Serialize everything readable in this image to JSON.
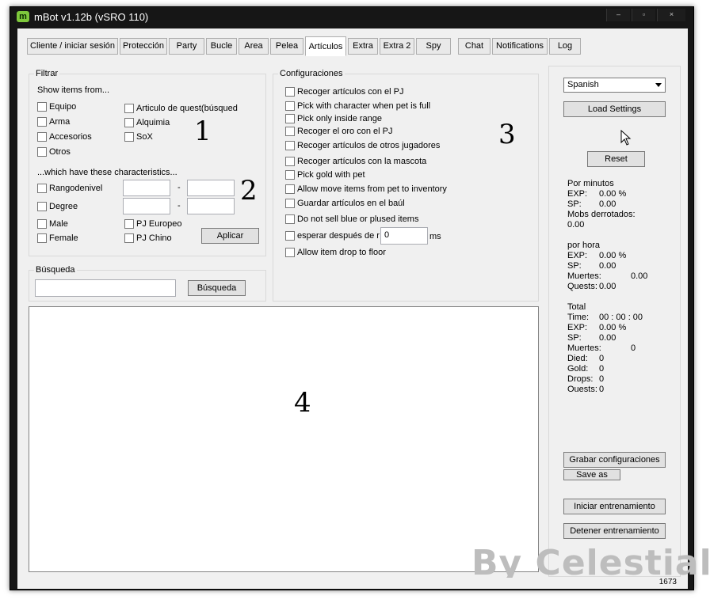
{
  "window": {
    "title": "mBot v1.12b (vSRO 110)",
    "logo_letter": "m",
    "min": "–",
    "max": "▫",
    "close": "×"
  },
  "tabs": [
    "Cliente / iniciar sesión",
    "Protección",
    "Party",
    "Bucle",
    "Area",
    "Pelea",
    "Artículos",
    "Extra",
    "Extra 2",
    "Spy",
    "Chat",
    "Notifications",
    "Log"
  ],
  "active_tab": "Artículos",
  "filtrar": {
    "legend": "Filtrar",
    "show_items_from": "Show items from...",
    "left_items": [
      "Equipo",
      "Arma",
      "Accesorios",
      "Otros"
    ],
    "right_items": [
      "Articulo de quest(búsqued",
      "Alquimia",
      "SoX"
    ],
    "characteristics_label": "...which have these characteristics...",
    "range_items": [
      "Rangodenivel",
      "Degree"
    ],
    "dash": "-",
    "gender_items": [
      "Male",
      "Female"
    ],
    "race_items": [
      "PJ Europeo",
      "PJ Chino"
    ],
    "apply_button": "Aplicar"
  },
  "busqueda": {
    "legend": "Búsqueda",
    "input_value": "",
    "search_button": "Búsqueda"
  },
  "configuraciones": {
    "legend": "Configuraciones",
    "items": [
      "Recoger artículos con el PJ",
      "Pick with character when pet is full",
      "Pick only inside range",
      "Recoger el oro con el PJ",
      "Recoger artículos de otros jugadores",
      "Recoger artículos con la mascota",
      "Pick gold with pet",
      "Allow move items from pet to inventory",
      "Guardar artículos en el baúl",
      "Do not sell blue or plused items",
      "esperar después de r",
      "Allow item drop to floor"
    ],
    "wait_value": "0",
    "wait_unit": "ms"
  },
  "annotations": [
    "1",
    "2",
    "3",
    "4"
  ],
  "right_panel": {
    "language": "Spanish",
    "load_settings": "Load Settings",
    "reset": "Reset",
    "por_minutos": {
      "header": "Por minutos",
      "exp_label": "EXP:",
      "exp_value": "0.00 %",
      "sp_label": "SP:",
      "sp_value": "0.00",
      "mobs_label": "Mobs derrotados:",
      "mobs_value": "0.00"
    },
    "por_hora": {
      "header": "por hora",
      "exp_label": "EXP:",
      "exp_value": "0.00 %",
      "sp_label": "SP:",
      "sp_value": "0.00",
      "muertes_label": "Muertes:",
      "muertes_value": "0.00",
      "quests_label": "Quests:",
      "quests_value": "0.00"
    },
    "total": {
      "header": "Total",
      "time_label": "Time:",
      "time_value": "00 : 00 : 00",
      "exp_label": "EXP:",
      "exp_value": "0.00 %",
      "sp_label": "SP:",
      "sp_value": "0.00",
      "muertes_label": "Muertes:",
      "muertes_value": "0",
      "died_label": "Died:",
      "died_value": "0",
      "gold_label": "Gold:",
      "gold_value": "0",
      "drops_label": "Drops:",
      "drops_value": "0",
      "quests_label": "Ouests:",
      "quests_value": "0"
    },
    "save_config": "Grabar configuraciones",
    "save_as": "Save as",
    "start_training": "Iniciar entrenamiento",
    "stop_training": "Detener entrenamiento"
  },
  "watermark": "By Celestial",
  "status": {
    "count": "1673"
  }
}
